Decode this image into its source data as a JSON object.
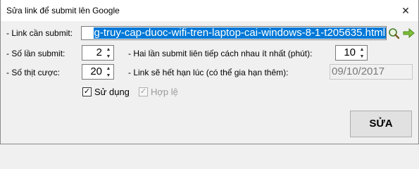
{
  "window": {
    "title": "Sửa link để submit lên Google",
    "close_glyph": "✕"
  },
  "link": {
    "label": "- Link cần submit:",
    "value": "g-truy-cap-duoc-wifi-tren-laptop-cai-windows-8-1-t205635.html",
    "search_icon": "magnifier-icon",
    "go_icon": "green-arrow-icon"
  },
  "submit_count": {
    "label": "- Số lần submit:",
    "value": "2"
  },
  "interval": {
    "label": "- Hai lần submit liên tiếp cách nhau ít nhất (phút):",
    "value": "10"
  },
  "bid": {
    "label": "- Số thịt cược:",
    "value": "20"
  },
  "expiry": {
    "label": "- Link sẽ hết hạn lúc (có thể gia hạn thêm):",
    "value": "09/10/2017"
  },
  "use": {
    "label": "Sử dụng",
    "checked": true
  },
  "valid": {
    "label": "Hợp lệ",
    "checked": true,
    "disabled": true
  },
  "save_button": {
    "label": "SỬA"
  },
  "colors": {
    "selection": "#0078d7",
    "background": "#f0f0f0"
  }
}
